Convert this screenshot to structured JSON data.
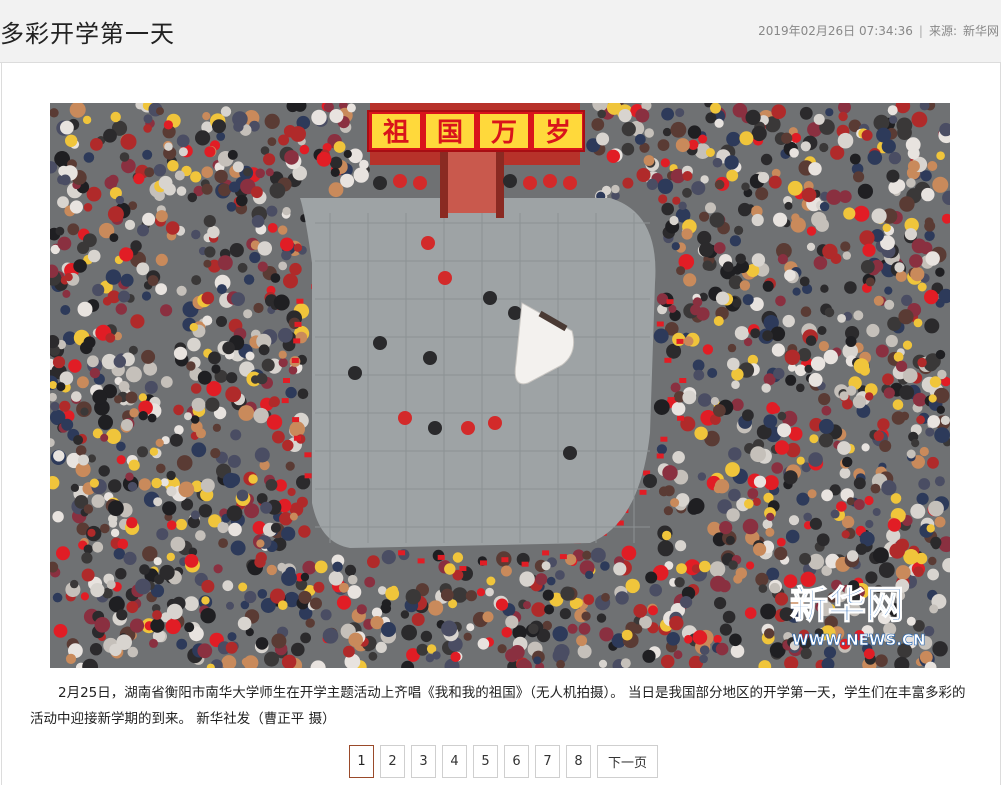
{
  "article": {
    "title": "多彩开学第一天",
    "date": "2019年02月26日 07:34:36",
    "source_label": "来源:",
    "source": "新华网",
    "caption": "2月25日，湖南省衡阳市南华大学师生在开学主题活动上齐唱《我和我的祖国》（无人机拍摄）。 当日是我国部分地区的开学第一天，学生们在丰富多彩的活动中迎接新学期的到来。 新华社发（曹正平 摄）"
  },
  "photo": {
    "banner_chars": [
      "祖",
      "国",
      "万",
      "岁"
    ],
    "watermark_cn": "新华网",
    "watermark_en": "WWW.NEWS.CN",
    "colors": {
      "banner": "#d9141b",
      "banner_text": "#ffd93b",
      "square": "#9aa0a2",
      "crowd_dark": "#2b2a2c",
      "flag_red": "#e11d25"
    }
  },
  "pagination": {
    "pages": [
      "1",
      "2",
      "3",
      "4",
      "5",
      "6",
      "7",
      "8"
    ],
    "current": "1",
    "next_label": "下一页"
  }
}
